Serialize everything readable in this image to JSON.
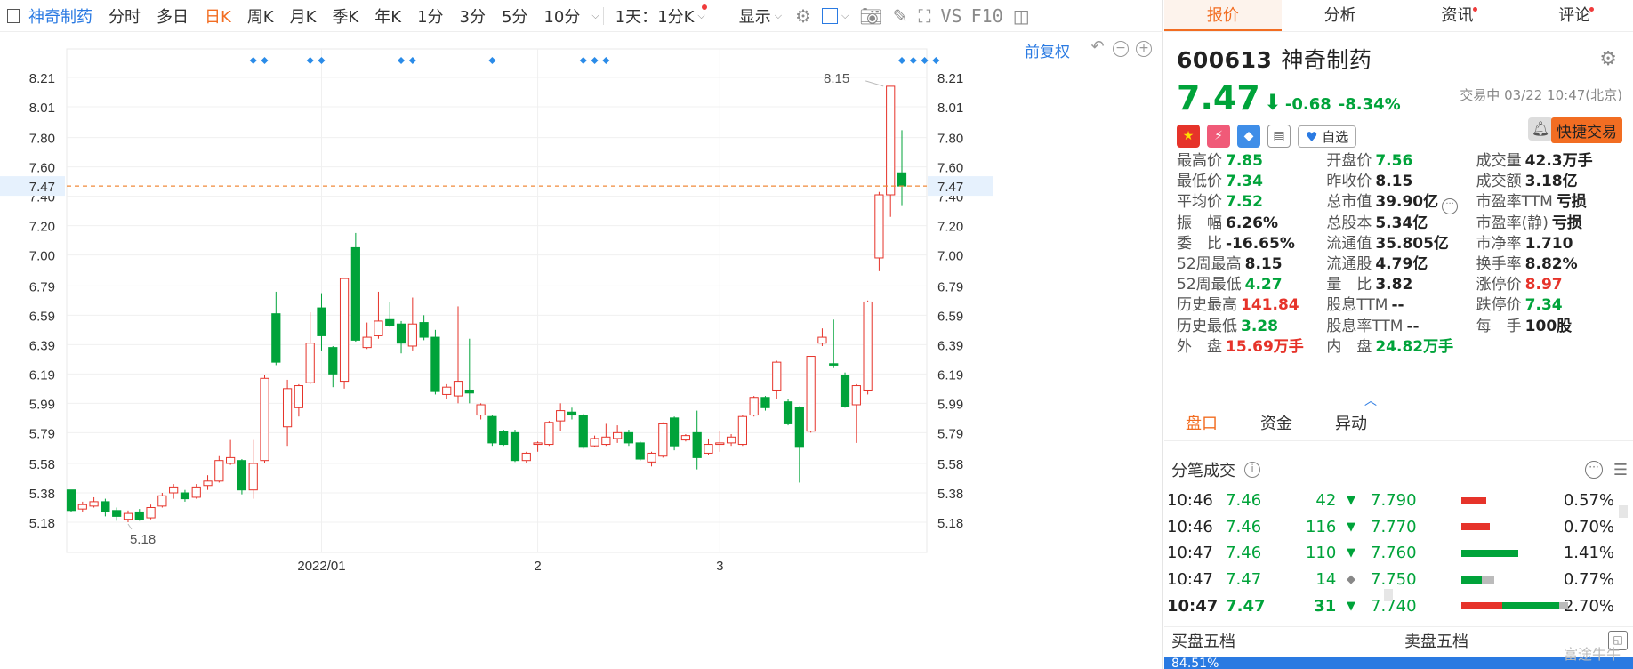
{
  "toolbar": {
    "stock_name": "神奇制药",
    "periods": [
      "分时",
      "多日",
      "日K",
      "周K",
      "月K",
      "季K",
      "年K",
      "1分",
      "3分",
      "5分",
      "10分"
    ],
    "active_period": "日K",
    "interval_select": "1天：1分K",
    "display_label": "显示",
    "vs_label": "VS",
    "f10_label": "F10"
  },
  "chart": {
    "fuquan_label": "前复权",
    "current_price_label": "7.47",
    "high_annotation": "8.15",
    "low_annotation": "5.18",
    "y_ticks": [
      "8.21",
      "8.01",
      "7.80",
      "7.60",
      "7.40",
      "7.20",
      "7.00",
      "6.79",
      "6.59",
      "6.39",
      "6.19",
      "5.99",
      "5.79",
      "5.58",
      "5.38",
      "5.18"
    ],
    "x_labels": [
      "2022/01",
      "2",
      "3"
    ]
  },
  "chart_data": {
    "type": "candlestick",
    "ylim": [
      5.05,
      8.3
    ],
    "y_ticks": [
      8.21,
      8.01,
      7.8,
      7.6,
      7.4,
      7.2,
      7.0,
      6.79,
      6.59,
      6.39,
      6.19,
      5.99,
      5.79,
      5.58,
      5.38,
      5.18
    ],
    "current_price": 7.47,
    "annotations": [
      {
        "text": "8.15",
        "value": 8.15
      },
      {
        "text": "5.18",
        "value": 5.18
      }
    ],
    "x_labels": [
      {
        "label": "2022/01",
        "index": 22
      },
      {
        "label": "2",
        "index": 41
      },
      {
        "label": "3",
        "index": 57
      }
    ],
    "candles": [
      {
        "o": 5.4,
        "c": 5.26,
        "h": 5.4,
        "l": 5.25
      },
      {
        "o": 5.27,
        "c": 5.3,
        "h": 5.32,
        "l": 5.25
      },
      {
        "o": 5.29,
        "c": 5.32,
        "h": 5.35,
        "l": 5.28
      },
      {
        "o": 5.32,
        "c": 5.25,
        "h": 5.34,
        "l": 5.22
      },
      {
        "o": 5.26,
        "c": 5.22,
        "h": 5.28,
        "l": 5.19
      },
      {
        "o": 5.2,
        "c": 5.24,
        "h": 5.26,
        "l": 5.18
      },
      {
        "o": 5.25,
        "c": 5.2,
        "h": 5.27,
        "l": 5.19
      },
      {
        "o": 5.21,
        "c": 5.28,
        "h": 5.3,
        "l": 5.2
      },
      {
        "o": 5.29,
        "c": 5.36,
        "h": 5.38,
        "l": 5.28
      },
      {
        "o": 5.38,
        "c": 5.42,
        "h": 5.44,
        "l": 5.34
      },
      {
        "o": 5.38,
        "c": 5.34,
        "h": 5.4,
        "l": 5.32
      },
      {
        "o": 5.35,
        "c": 5.42,
        "h": 5.44,
        "l": 5.34
      },
      {
        "o": 5.43,
        "c": 5.46,
        "h": 5.5,
        "l": 5.4
      },
      {
        "o": 5.46,
        "c": 5.6,
        "h": 5.63,
        "l": 5.45
      },
      {
        "o": 5.58,
        "c": 5.62,
        "h": 5.74,
        "l": 5.57
      },
      {
        "o": 5.6,
        "c": 5.4,
        "h": 5.61,
        "l": 5.37
      },
      {
        "o": 5.4,
        "c": 5.58,
        "h": 5.74,
        "l": 5.34
      },
      {
        "o": 5.6,
        "c": 6.16,
        "h": 6.18,
        "l": 5.58
      },
      {
        "o": 6.6,
        "c": 6.27,
        "h": 6.75,
        "l": 6.25
      },
      {
        "o": 5.83,
        "c": 6.09,
        "h": 6.15,
        "l": 5.7
      },
      {
        "o": 5.96,
        "c": 6.11,
        "h": 6.12,
        "l": 5.9
      },
      {
        "o": 6.13,
        "c": 6.4,
        "h": 6.61,
        "l": 6.12
      },
      {
        "o": 6.64,
        "c": 6.45,
        "h": 6.74,
        "l": 6.35
      },
      {
        "o": 6.37,
        "c": 6.19,
        "h": 6.38,
        "l": 6.1
      },
      {
        "o": 6.14,
        "c": 6.84,
        "h": 6.84,
        "l": 6.09
      },
      {
        "o": 7.05,
        "c": 6.42,
        "h": 7.15,
        "l": 6.41
      },
      {
        "o": 6.37,
        "c": 6.44,
        "h": 6.54,
        "l": 6.36
      },
      {
        "o": 6.45,
        "c": 6.55,
        "h": 6.75,
        "l": 6.43
      },
      {
        "o": 6.56,
        "c": 6.52,
        "h": 6.68,
        "l": 6.51
      },
      {
        "o": 6.53,
        "c": 6.4,
        "h": 6.55,
        "l": 6.33
      },
      {
        "o": 6.38,
        "c": 6.53,
        "h": 6.71,
        "l": 6.35
      },
      {
        "o": 6.54,
        "c": 6.44,
        "h": 6.59,
        "l": 6.42
      },
      {
        "o": 6.44,
        "c": 6.07,
        "h": 6.49,
        "l": 6.05
      },
      {
        "o": 6.05,
        "c": 6.1,
        "h": 6.12,
        "l": 6.02
      },
      {
        "o": 6.04,
        "c": 6.14,
        "h": 6.65,
        "l": 5.99
      },
      {
        "o": 6.08,
        "c": 6.06,
        "h": 6.43,
        "l": 5.99
      },
      {
        "o": 5.91,
        "c": 5.98,
        "h": 5.99,
        "l": 5.88
      },
      {
        "o": 5.9,
        "c": 5.72,
        "h": 5.91,
        "l": 5.7
      },
      {
        "o": 5.8,
        "c": 5.71,
        "h": 5.81,
        "l": 5.7
      },
      {
        "o": 5.79,
        "c": 5.6,
        "h": 5.81,
        "l": 5.59
      },
      {
        "o": 5.6,
        "c": 5.65,
        "h": 5.66,
        "l": 5.58
      },
      {
        "o": 5.71,
        "c": 5.72,
        "h": 5.73,
        "l": 5.66
      },
      {
        "o": 5.71,
        "c": 5.86,
        "h": 5.87,
        "l": 5.7
      },
      {
        "o": 5.87,
        "c": 5.94,
        "h": 5.99,
        "l": 5.8
      },
      {
        "o": 5.93,
        "c": 5.91,
        "h": 5.96,
        "l": 5.88
      },
      {
        "o": 5.91,
        "c": 5.69,
        "h": 5.92,
        "l": 5.68
      },
      {
        "o": 5.7,
        "c": 5.75,
        "h": 5.77,
        "l": 5.69
      },
      {
        "o": 5.71,
        "c": 5.76,
        "h": 5.85,
        "l": 5.7
      },
      {
        "o": 5.75,
        "c": 5.79,
        "h": 5.84,
        "l": 5.72
      },
      {
        "o": 5.79,
        "c": 5.72,
        "h": 5.81,
        "l": 5.7
      },
      {
        "o": 5.72,
        "c": 5.61,
        "h": 5.73,
        "l": 5.6
      },
      {
        "o": 5.59,
        "c": 5.65,
        "h": 5.66,
        "l": 5.56
      },
      {
        "o": 5.63,
        "c": 5.85,
        "h": 5.86,
        "l": 5.62
      },
      {
        "o": 5.89,
        "c": 5.7,
        "h": 5.9,
        "l": 5.67
      },
      {
        "o": 5.74,
        "c": 5.77,
        "h": 5.78,
        "l": 5.73
      },
      {
        "o": 5.79,
        "c": 5.62,
        "h": 5.94,
        "l": 5.54
      },
      {
        "o": 5.65,
        "c": 5.71,
        "h": 5.75,
        "l": 5.64
      },
      {
        "o": 5.71,
        "c": 5.72,
        "h": 5.8,
        "l": 5.66
      },
      {
        "o": 5.72,
        "c": 5.76,
        "h": 5.78,
        "l": 5.7
      },
      {
        "o": 5.71,
        "c": 5.9,
        "h": 5.91,
        "l": 5.7
      },
      {
        "o": 5.91,
        "c": 6.03,
        "h": 6.04,
        "l": 5.9
      },
      {
        "o": 6.03,
        "c": 5.96,
        "h": 6.04,
        "l": 5.94
      },
      {
        "o": 6.08,
        "c": 6.27,
        "h": 6.28,
        "l": 6.02
      },
      {
        "o": 6.0,
        "c": 5.85,
        "h": 6.02,
        "l": 5.84
      },
      {
        "o": 5.96,
        "c": 5.69,
        "h": 5.97,
        "l": 5.45
      },
      {
        "o": 5.8,
        "c": 6.31,
        "h": 6.31,
        "l": 5.79
      },
      {
        "o": 6.4,
        "c": 6.44,
        "h": 6.5,
        "l": 6.38
      },
      {
        "o": 6.26,
        "c": 6.25,
        "h": 6.56,
        "l": 6.23
      },
      {
        "o": 6.18,
        "c": 5.97,
        "h": 6.2,
        "l": 5.96
      },
      {
        "o": 5.98,
        "c": 6.11,
        "h": 6.12,
        "l": 5.72
      },
      {
        "o": 6.08,
        "c": 6.68,
        "h": 6.69,
        "l": 6.05
      },
      {
        "o": 6.98,
        "c": 7.41,
        "h": 7.43,
        "l": 6.89
      },
      {
        "o": 7.41,
        "c": 8.15,
        "h": 8.15,
        "l": 7.26
      },
      {
        "o": 7.56,
        "c": 7.47,
        "h": 7.85,
        "l": 7.34
      }
    ],
    "marker_indices": [
      16,
      17,
      21,
      22,
      29,
      30,
      37,
      45,
      46,
      47,
      73,
      74,
      75,
      76
    ]
  },
  "quote_tabs": [
    "报价",
    "分析",
    "资讯",
    "评论"
  ],
  "quote": {
    "code": "600613",
    "name": "神奇制药",
    "price": "7.47",
    "change": "-0.68",
    "change_pct": "-8.34%",
    "status": "交易中 03/22 10:47(北京)",
    "watch_label": "自选",
    "quick_trade_label": "快捷交易"
  },
  "stats": [
    [
      {
        "label": "最高价",
        "value": "7.85",
        "color": "g"
      },
      {
        "label": "开盘价",
        "value": "7.56",
        "color": "g"
      },
      {
        "label": "成交量",
        "value": "42.3万手",
        "color": "k"
      }
    ],
    [
      {
        "label": "最低价",
        "value": "7.34",
        "color": "g"
      },
      {
        "label": "昨收价",
        "value": "8.15",
        "color": "k"
      },
      {
        "label": "成交额",
        "value": "3.18亿",
        "color": "k"
      }
    ],
    [
      {
        "label": "平均价",
        "value": "7.52",
        "color": "g"
      },
      {
        "label": "总市值",
        "value": "39.90亿",
        "color": "k"
      },
      {
        "label": "市盈率TTM",
        "value": "亏损",
        "color": "k"
      }
    ],
    [
      {
        "label": "振　幅",
        "value": "6.26%",
        "color": "k"
      },
      {
        "label": "总股本",
        "value": "5.34亿",
        "color": "k"
      },
      {
        "label": "市盈率(静)",
        "value": "亏损",
        "color": "k"
      }
    ],
    [
      {
        "label": "委　比",
        "value": "-16.65%",
        "color": "k"
      },
      {
        "label": "流通值",
        "value": "35.805亿",
        "color": "k"
      },
      {
        "label": "市净率",
        "value": "1.710",
        "color": "k"
      }
    ],
    [
      {
        "label": "52周最高",
        "value": "8.15",
        "color": "k"
      },
      {
        "label": "流通股",
        "value": "4.79亿",
        "color": "k"
      },
      {
        "label": "换手率",
        "value": "8.82%",
        "color": "k"
      }
    ],
    [
      {
        "label": "52周最低",
        "value": "4.27",
        "color": "g"
      },
      {
        "label": "量　比",
        "value": "3.82",
        "color": "k"
      },
      {
        "label": "涨停价",
        "value": "8.97",
        "color": "r"
      }
    ],
    [
      {
        "label": "历史最高",
        "value": "141.84",
        "color": "r"
      },
      {
        "label": "股息TTM",
        "value": "--",
        "color": "k"
      },
      {
        "label": "跌停价",
        "value": "7.34",
        "color": "g"
      }
    ],
    [
      {
        "label": "历史最低",
        "value": "3.28",
        "color": "g"
      },
      {
        "label": "股息率TTM",
        "value": "--",
        "color": "k"
      },
      {
        "label": "每　手",
        "value": "100股",
        "color": "k"
      }
    ],
    [
      {
        "label": "外　盘",
        "value": "15.69万手",
        "color": "r"
      },
      {
        "label": "内　盘",
        "value": "24.82万手",
        "color": "g"
      },
      {
        "label": "",
        "value": "",
        "color": "k"
      }
    ]
  ],
  "sub_tabs": [
    "盘口",
    "资金",
    "异动"
  ],
  "ticks_title": "分笔成交",
  "ticks": [
    {
      "time": "10:46",
      "price": "7.46",
      "vol": "42",
      "dir": "▼",
      "dcolor": "g"
    },
    {
      "time": "10:46",
      "price": "7.46",
      "vol": "116",
      "dir": "▼",
      "dcolor": "g"
    },
    {
      "time": "10:47",
      "price": "7.46",
      "vol": "110",
      "dir": "▼",
      "dcolor": "g"
    },
    {
      "time": "10:47",
      "price": "7.47",
      "vol": "14",
      "dir": "◆",
      "dcolor": "k"
    },
    {
      "time": "10:47",
      "price": "7.47",
      "vol": "31",
      "dir": "▼",
      "dcolor": "g"
    }
  ],
  "depth": [
    {
      "price": "7.790",
      "pct": "0.57%",
      "bars": [
        {
          "c": "#e6332a",
          "w": 0.12
        }
      ]
    },
    {
      "price": "7.770",
      "pct": "0.70%",
      "bars": [
        {
          "c": "#e6332a",
          "w": 0.14
        }
      ]
    },
    {
      "price": "7.760",
      "pct": "1.41%",
      "bars": [
        {
          "c": "#00a33a",
          "w": 0.28
        }
      ]
    },
    {
      "price": "7.750",
      "pct": "0.77%",
      "bars": [
        {
          "c": "#00a33a",
          "w": 0.1
        },
        {
          "c": "#bbb",
          "w": 0.06
        }
      ]
    },
    {
      "price": "7.740",
      "pct": "2.70%",
      "bars": [
        {
          "c": "#e6332a",
          "w": 0.2
        },
        {
          "c": "#00a33a",
          "w": 0.28
        },
        {
          "c": "#bbb",
          "w": 0.04
        }
      ]
    }
  ],
  "ladder": {
    "buy_label": "买盘五档",
    "sell_label": "卖盘五档",
    "ratio": "84.51%"
  },
  "watermark": "富途牛牛"
}
